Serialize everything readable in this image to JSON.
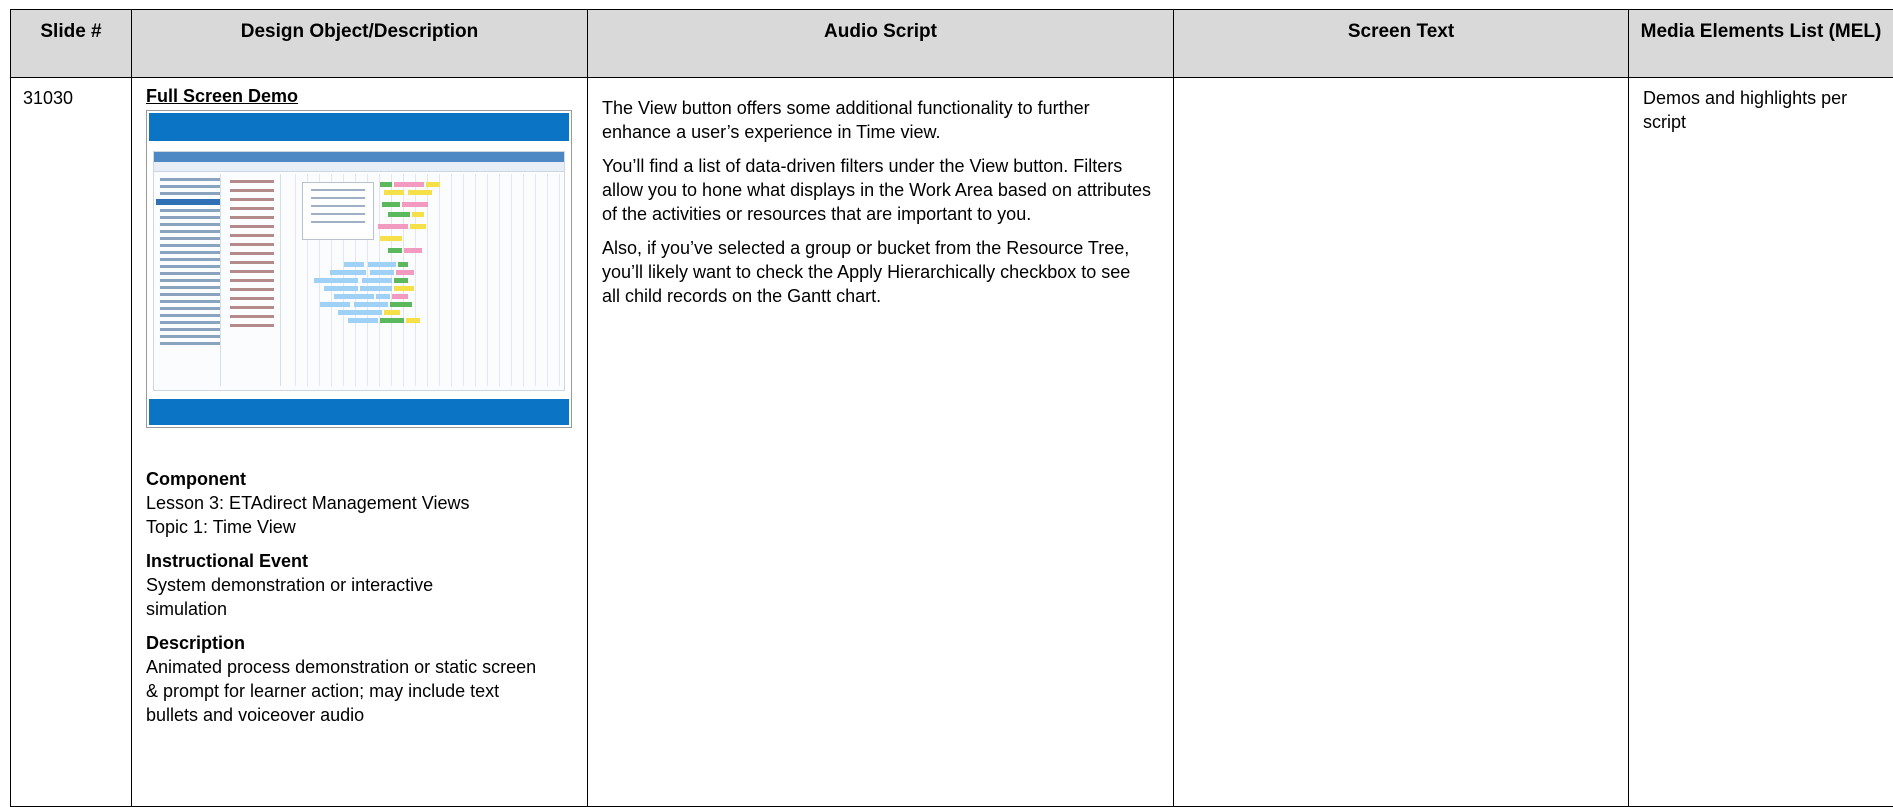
{
  "table": {
    "headers": {
      "slide": "Slide #",
      "design": "Design Object/Description",
      "audio": "Audio Script",
      "screen": "Screen Text",
      "mel": "Media Elements List (MEL)"
    },
    "row": {
      "slide_number": "31030",
      "design_title": "Full Screen Demo",
      "component_label": "Component",
      "component_lesson": "Lesson 3: ETAdirect Management Views",
      "component_topic": "Topic 1: Time View",
      "event_label": "Instructional Event",
      "event_text": "System demonstration or interactive simulation",
      "description_label": "Description",
      "description_text": "Animated process demonstration or static screen & prompt for learner action; may include text bullets and voiceover audio",
      "audio_p1": "The View button offers some additional functionality to further enhance a user’s experience in Time view.",
      "audio_p2": "You’ll find a list of data-driven filters under the View button. Filters allow you to hone what displays in the Work Area based on attributes of the activities or resources that are important to you.",
      "audio_p3": "Also, if you’ve selected a group or bucket from the Resource Tree, you’ll likely want to check the Apply Hierarchically checkbox to see all child records on the Gantt chart.",
      "screen_text": "",
      "mel_text": "Demos and highlights per script"
    }
  },
  "colors": {
    "header_bg": "#d9d9d9",
    "thumb_frame": "#0b74c4"
  }
}
